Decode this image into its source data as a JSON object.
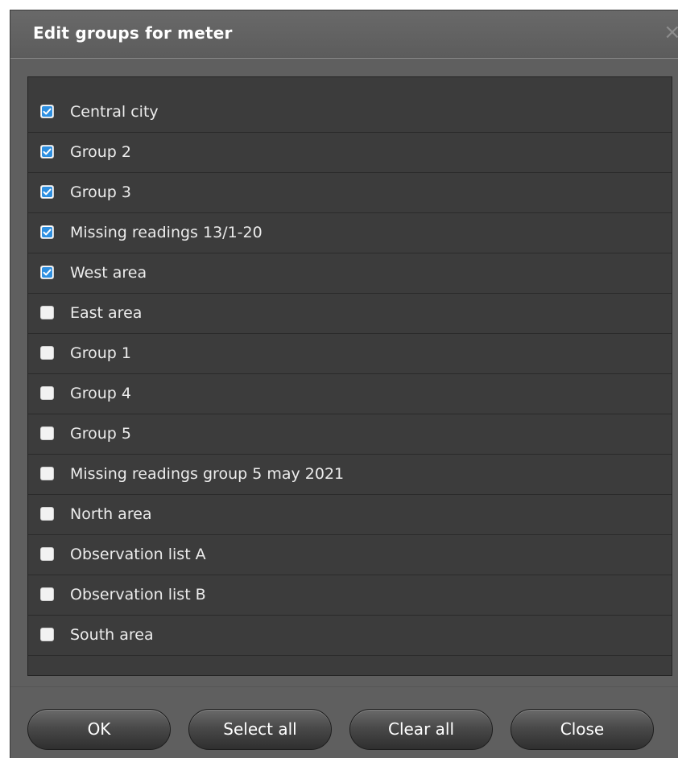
{
  "dialog": {
    "title": "Edit groups for meter",
    "close_glyph": "×"
  },
  "groups": [
    {
      "label": "Central city",
      "checked": true
    },
    {
      "label": "Group 2",
      "checked": true
    },
    {
      "label": "Group 3",
      "checked": true
    },
    {
      "label": "Missing readings 13/1-20",
      "checked": true
    },
    {
      "label": "West area",
      "checked": true
    },
    {
      "label": "East area",
      "checked": false
    },
    {
      "label": "Group 1",
      "checked": false
    },
    {
      "label": "Group 4",
      "checked": false
    },
    {
      "label": "Group 5",
      "checked": false
    },
    {
      "label": "Missing readings group 5 may 2021",
      "checked": false
    },
    {
      "label": "North area",
      "checked": false
    },
    {
      "label": "Observation list A",
      "checked": false
    },
    {
      "label": "Observation list B",
      "checked": false
    },
    {
      "label": "South area",
      "checked": false
    }
  ],
  "buttons": {
    "ok": "OK",
    "select_all": "Select all",
    "clear_all": "Clear all",
    "close": "Close"
  },
  "colors": {
    "check_accent": "#2e8fe0",
    "dialog_bg": "#5f5f5f",
    "list_bg": "#3c3c3c"
  }
}
